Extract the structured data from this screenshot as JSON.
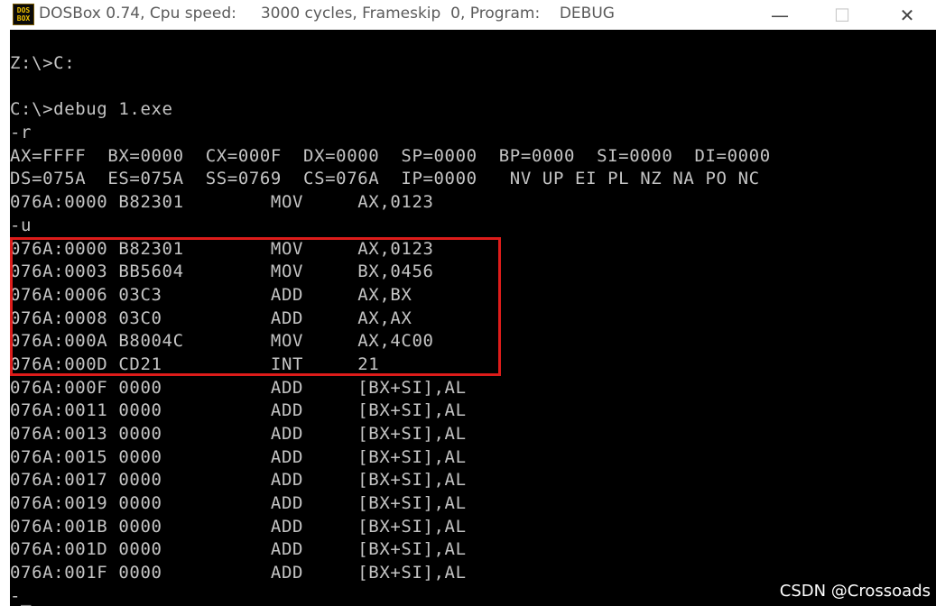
{
  "window": {
    "icon_label": "DOSBox",
    "icon_top": "DOS",
    "icon_bottom": "BOX",
    "title": "DOSBox 0.74, Cpu speed:     3000 cycles, Frameskip  0, Program:    DEBUG",
    "minimize_glyph": "—",
    "maximize_glyph": "☐",
    "close_glyph": "✕"
  },
  "colors": {
    "console_bg": "#000000",
    "console_text": "#c4c4c4",
    "highlight_border": "#dd1c1a",
    "titlebar_bg": "#ffffff"
  },
  "console": {
    "lines": [
      "",
      "Z:\\>C:",
      "",
      "C:\\>debug 1.exe",
      "-r",
      "AX=FFFF  BX=0000  CX=000F  DX=0000  SP=0000  BP=0000  SI=0000  DI=0000",
      "DS=075A  ES=075A  SS=0769  CS=076A  IP=0000   NV UP EI PL NZ NA PO NC",
      "076A:0000 B82301        MOV     AX,0123",
      "-u",
      "076A:0000 B82301        MOV     AX,0123",
      "076A:0003 BB5604        MOV     BX,0456",
      "076A:0006 03C3          ADD     AX,BX",
      "076A:0008 03C0          ADD     AX,AX",
      "076A:000A B8004C        MOV     AX,4C00",
      "076A:000D CD21          INT     21",
      "076A:000F 0000          ADD     [BX+SI],AL",
      "076A:0011 0000          ADD     [BX+SI],AL",
      "076A:0013 0000          ADD     [BX+SI],AL",
      "076A:0015 0000          ADD     [BX+SI],AL",
      "076A:0017 0000          ADD     [BX+SI],AL",
      "076A:0019 0000          ADD     [BX+SI],AL",
      "076A:001B 0000          ADD     [BX+SI],AL",
      "076A:001D 0000          ADD     [BX+SI],AL",
      "076A:001F 0000          ADD     [BX+SI],AL",
      "-_"
    ]
  },
  "watermark": "CSDN @Crossoads"
}
